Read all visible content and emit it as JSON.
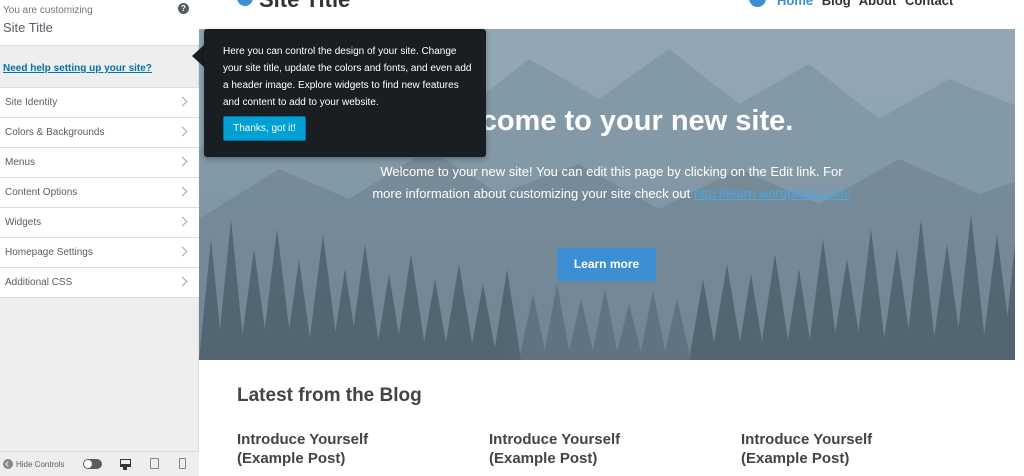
{
  "sidebar": {
    "customizing_label": "You are customizing",
    "site_title": "Site Title",
    "help_link": "Need help setting up your site?",
    "panels": [
      {
        "label": "Site Identity"
      },
      {
        "label": "Colors & Backgrounds"
      },
      {
        "label": "Menus"
      },
      {
        "label": "Content Options"
      },
      {
        "label": "Widgets"
      },
      {
        "label": "Homepage Settings"
      },
      {
        "label": "Additional CSS"
      }
    ],
    "footer": {
      "hide_label": "Hide Controls"
    }
  },
  "tooltip": {
    "text": "Here you can control the design of your site. Change your site title, update the colors and fonts, and even add a header image. Explore widgets to find new features and content to add to your website.",
    "button": "Thanks, got it!"
  },
  "preview": {
    "site_name": "Site Title",
    "nav": [
      "Home",
      "Blog",
      "About",
      "Contact"
    ],
    "hero": {
      "title": "Welcome to your new site.",
      "text": "Welcome to your new site! You can edit this page by clicking on the Edit link. For more information about customizing your site check out ",
      "link": "http://learn.wordpress.com/",
      "button": "Learn more"
    },
    "blog": {
      "heading": "Latest from the Blog",
      "posts": [
        {
          "title": "Introduce Yourself (Example Post)"
        },
        {
          "title": "Introduce Yourself (Example Post)"
        },
        {
          "title": "Introduce Yourself (Example Post)"
        }
      ]
    }
  },
  "colors": {
    "accent": "#3b8fd2",
    "tooltip_bg": "#191e23",
    "tooltip_button": "#00a0d2",
    "link": "#0073aa"
  }
}
